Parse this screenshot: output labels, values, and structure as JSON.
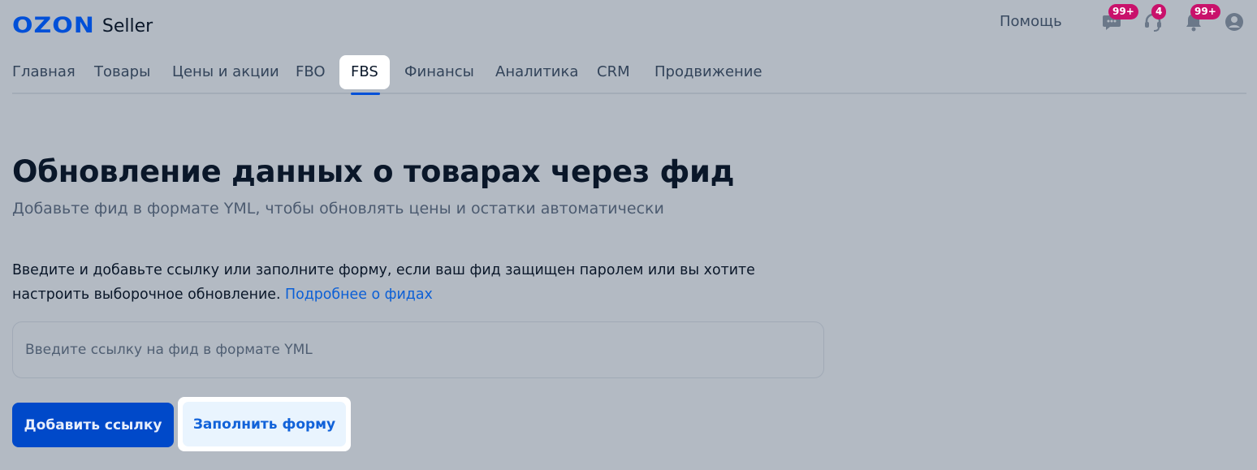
{
  "header": {
    "logo_brand": "OZON",
    "logo_product": "Seller",
    "help_label": "Помощь",
    "icons": [
      {
        "name": "chat-icon",
        "badge": "99+"
      },
      {
        "name": "support-headset-icon",
        "badge": "4"
      },
      {
        "name": "notifications-bell-icon",
        "badge": "99+"
      },
      {
        "name": "profile-avatar-icon",
        "badge": ""
      }
    ]
  },
  "nav": {
    "tabs": [
      {
        "label": "Главная"
      },
      {
        "label": "Товары"
      },
      {
        "label": "Цены и акции"
      },
      {
        "label": "FBO"
      },
      {
        "label": "FBS",
        "active": true
      },
      {
        "label": "Финансы"
      },
      {
        "label": "Аналитика"
      },
      {
        "label": "CRM"
      },
      {
        "label": "Продвижение"
      }
    ]
  },
  "main": {
    "title": "Обновление данных о товарах через фид",
    "subtitle": "Добавьте фид в формате YML, чтобы обновлять цены и остатки автоматически",
    "description": "Введите и добавьте ссылку или заполните форму, если ваш фид защищен паролем или вы хотите настроить выборочное обновление.",
    "description_link": "Подробнее о фидах",
    "input": {
      "value": "",
      "placeholder": "Введите ссылку на фид в формате YML"
    },
    "add_link_button": "Добавить ссылку",
    "fill_form_button": "Заполнить форму"
  },
  "colors": {
    "brand": "#0050d8",
    "primary_button": "#0049c9",
    "badge": "#c9116b",
    "link": "#0b5fd6",
    "page_overlay": "#b3bac3"
  }
}
